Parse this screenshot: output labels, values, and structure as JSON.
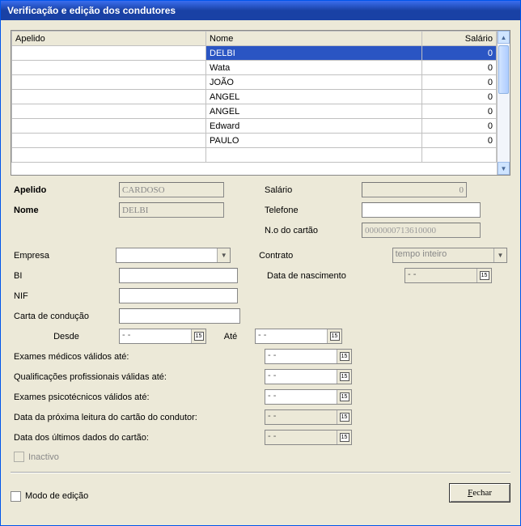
{
  "window": {
    "title": "Verificação e edição dos condutores"
  },
  "table": {
    "headers": {
      "apelido": "Apelido",
      "nome": "Nome",
      "salario": "Salário"
    },
    "rows": [
      {
        "apelido": "",
        "nome": "DELBI",
        "salario": "0",
        "selected": true
      },
      {
        "apelido": "",
        "nome": "Wata",
        "salario": "0"
      },
      {
        "apelido": "",
        "nome": "JOÃO",
        "salario": "0"
      },
      {
        "apelido": "",
        "nome": "ANGEL",
        "salario": "0"
      },
      {
        "apelido": "",
        "nome": "ANGEL",
        "salario": "0"
      },
      {
        "apelido": "",
        "nome": "Edward",
        "salario": "0"
      },
      {
        "apelido": "",
        "nome": "PAULO",
        "salario": "0"
      },
      {
        "apelido": "",
        "nome": "",
        "salario": ""
      }
    ]
  },
  "form": {
    "apelido": {
      "label": "Apelido",
      "value": "CARDOSO"
    },
    "nome": {
      "label": "Nome",
      "value": "DELBI"
    },
    "salario": {
      "label": "Salário",
      "value": "0"
    },
    "telefone": {
      "label": "Telefone",
      "value": ""
    },
    "ncartao": {
      "label": "N.o do cartão",
      "value": "0000000713610000"
    },
    "empresa": {
      "label": "Empresa",
      "value": ""
    },
    "contrato": {
      "label": "Contrato",
      "value": "tempo inteiro"
    },
    "bi": {
      "label": "BI",
      "value": ""
    },
    "data_nascimento": {
      "label": "Data de nascimento",
      "value": "- -"
    },
    "nif": {
      "label": "NIF",
      "value": ""
    },
    "carta_conducao": {
      "label": "Carta de condução",
      "value": ""
    },
    "desde": {
      "label": "Desde",
      "value": "- -"
    },
    "ate": {
      "label": "Até",
      "value": "- -"
    },
    "exames_medicos": {
      "label": "Exames médicos válidos até:",
      "value": "- -"
    },
    "qualificacoes": {
      "label": "Qualificações profissionais válidas até:",
      "value": "- -"
    },
    "exames_psico": {
      "label": "Exames psicotécnicos válidos até:",
      "value": "- -"
    },
    "proxima_leitura": {
      "label": "Data da próxima leitura do cartão do condutor:",
      "value": "- -"
    },
    "ultimos_dados": {
      "label": "Data dos últimos dados do cartão:",
      "value": "- -"
    },
    "inactivo": {
      "label": "Inactivo"
    }
  },
  "bottom": {
    "modo_edicao": "Modo de edição",
    "fechar_prefix": "F",
    "fechar_suffix": "echar"
  },
  "icons": {
    "cal": "15"
  }
}
